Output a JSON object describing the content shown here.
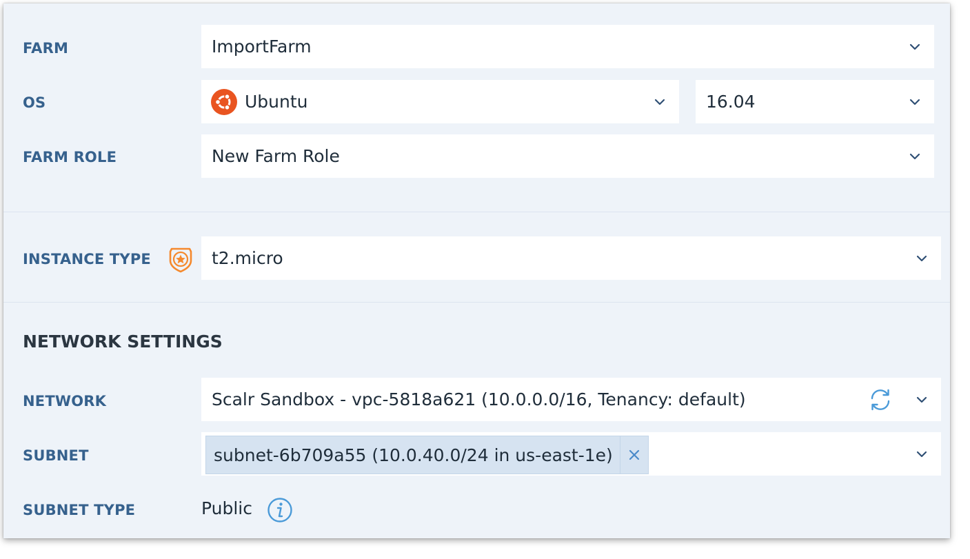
{
  "farm": {
    "label": "FARM",
    "value": "ImportFarm"
  },
  "os": {
    "label": "OS",
    "value": "Ubuntu",
    "icon": "ubuntu-logo-icon",
    "version": "16.04"
  },
  "farm_role": {
    "label": "FARM ROLE",
    "value": "New Farm Role"
  },
  "instance_type": {
    "label": "INSTANCE TYPE",
    "icon": "governance-badge-icon",
    "value": "t2.micro"
  },
  "network_settings": {
    "title": "NETWORK SETTINGS",
    "network": {
      "label": "NETWORK",
      "value": "Scalr Sandbox - vpc-5818a621 (10.0.0.0/16, Tenancy: default)",
      "icon": "refresh-icon"
    },
    "subnet": {
      "label": "SUBNET",
      "tag": "subnet-6b709a55 (10.0.40.0/24 in us-east-1e)",
      "remove_icon": "close-icon"
    },
    "subnet_type": {
      "label": "SUBNET TYPE",
      "value": "Public",
      "icon": "info-icon"
    }
  },
  "colors": {
    "panel_bg": "#eef3f9",
    "label": "#36618d",
    "accent_blue": "#4a9ad8",
    "ubuntu_orange": "#e95420",
    "badge_orange": "#f5892d",
    "tag_bg": "#d6e3f1"
  }
}
